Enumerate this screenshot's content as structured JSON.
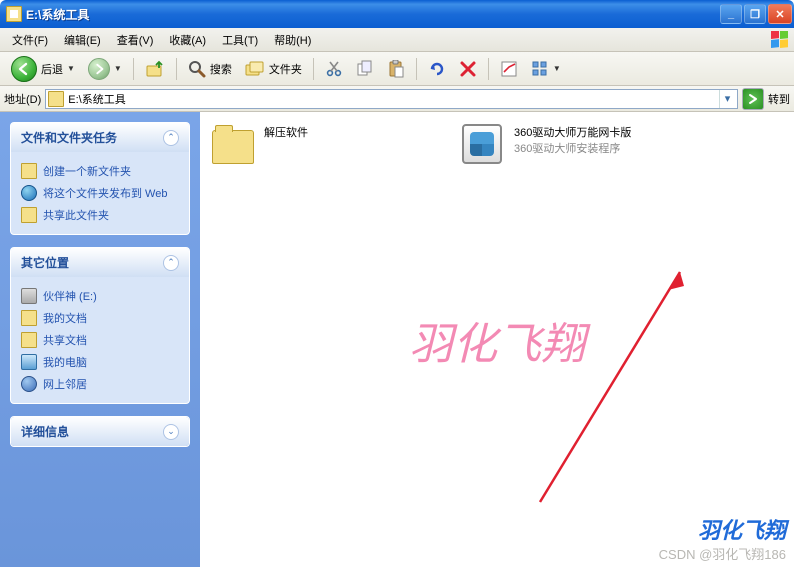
{
  "window": {
    "title": "E:\\系统工具"
  },
  "menu": {
    "file": "文件(F)",
    "edit": "编辑(E)",
    "view": "查看(V)",
    "favorites": "收藏(A)",
    "tools": "工具(T)",
    "help": "帮助(H)"
  },
  "toolbar": {
    "back_label": "后退",
    "search_label": "搜索",
    "folders_label": "文件夹"
  },
  "addressbar": {
    "label": "地址(D)",
    "path": "E:\\系统工具",
    "go_label": "转到"
  },
  "sidebar": {
    "tasks_panel_title": "文件和文件夹任务",
    "tasks": [
      {
        "label": "创建一个新文件夹"
      },
      {
        "label": "将这个文件夹发布到 Web"
      },
      {
        "label": "共享此文件夹"
      }
    ],
    "other_panel_title": "其它位置",
    "places": [
      {
        "label": "伙伴神 (E:)"
      },
      {
        "label": "我的文档"
      },
      {
        "label": "共享文档"
      },
      {
        "label": "我的电脑"
      },
      {
        "label": "网上邻居"
      }
    ],
    "details_panel_title": "详细信息"
  },
  "items": [
    {
      "name": "解压软件",
      "subtitle": ""
    },
    {
      "name": "360驱动大师万能网卡版",
      "subtitle": "360驱动大师安装程序"
    }
  ],
  "watermark": "羽化飞翔",
  "footer": {
    "brand": "羽化飞翔",
    "csdn": "CSDN @羽化飞翔186"
  }
}
